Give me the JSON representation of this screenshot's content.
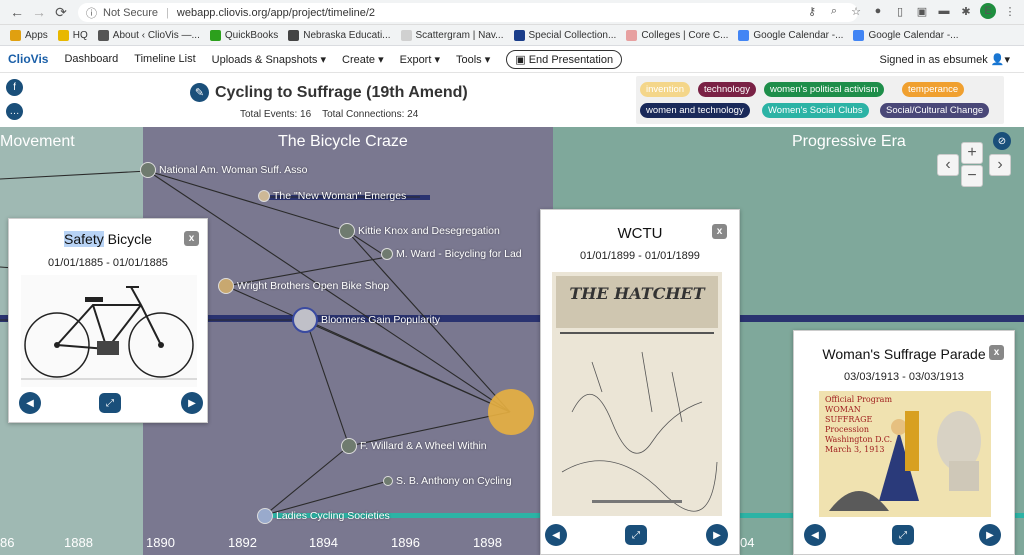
{
  "browser": {
    "not_secure": "Not Secure",
    "url": "webapp.cliovis.org/app/project/timeline/2",
    "profile_initial": "E"
  },
  "bookmarks": [
    {
      "label": "Apps",
      "color": "#e0a010"
    },
    {
      "label": "HQ",
      "color": "#e8b800"
    },
    {
      "label": "About ‹ ClioVis —...",
      "color": "#555555"
    },
    {
      "label": "QuickBooks",
      "color": "#2ca01c"
    },
    {
      "label": "Nebraska Educati...",
      "color": "#444444"
    },
    {
      "label": "Scattergram | Nav...",
      "color": "#d0d0d0"
    },
    {
      "label": "Special Collection...",
      "color": "#1a3d8a"
    },
    {
      "label": "Colleges | Core C...",
      "color": "#e7a0a0"
    },
    {
      "label": "Google Calendar -...",
      "color": "#4285f4"
    },
    {
      "label": "Google Calendar -...",
      "color": "#4285f4"
    }
  ],
  "appnav": {
    "brand": "ClioVis",
    "items": [
      "Dashboard",
      "Timeline List",
      "Uploads & Snapshots ▾",
      "Create ▾",
      "Export ▾",
      "Tools ▾"
    ],
    "end_presentation": "End Presentation",
    "signed_in": "Signed in as ebsumek"
  },
  "project": {
    "title": "Cycling to Suffrage (19th Amend)",
    "total_events": "Total Events: 16",
    "total_connections": "Total Connections: 24"
  },
  "tags": [
    {
      "label": "invention",
      "bg": "#f4d68a",
      "fg": "#ffffff"
    },
    {
      "label": "technology",
      "bg": "#7a2245",
      "fg": "#ffffff"
    },
    {
      "label": "women's political activism",
      "bg": "#1e8e4a",
      "fg": "#ffffff"
    },
    {
      "label": "temperance",
      "bg": "#f0a030",
      "fg": "#ffffff"
    },
    {
      "label": "women and technology",
      "bg": "#1a2a5a",
      "fg": "#ffffff"
    },
    {
      "label": "Women's Social Clubs",
      "bg": "#2cb3a5",
      "fg": "#ffffff"
    },
    {
      "label": "Social/Cultural Change",
      "bg": "#4a4878",
      "fg": "#ffffff"
    }
  ],
  "timeline": {
    "eras": [
      "Movement",
      "The Bicycle Craze",
      "Progressive Era"
    ],
    "years": [
      "86",
      "1888",
      "1890",
      "1892",
      "1894",
      "1896",
      "1898",
      "04"
    ],
    "events": [
      "National Am. Woman Suff. Asso",
      "The \"New Woman\" Emerges",
      "Kittie Knox and Desegregation",
      "M. Ward - Bicycling for Lad",
      "Wright Brothers Open Bike Shop",
      "Bloomers Gain Popularity",
      "F. Willard & A Wheel Within",
      "S. B. Anthony on Cycling",
      "Ladies Cycling Societies"
    ],
    "zoom_in": "+",
    "zoom_out": "−",
    "pan_left": "‹",
    "pan_right": "›"
  },
  "cards": {
    "safety": {
      "title_pre": "Safety",
      "title_post": " Bicycle",
      "date": "01/01/1885 - 01/01/1885",
      "close": "x"
    },
    "wctu": {
      "title": "WCTU",
      "date": "01/01/1899 - 01/01/1899",
      "close": "x",
      "image_caption": "THE HATCHET"
    },
    "parade": {
      "title": "Woman's Suffrage Parade",
      "date": "03/03/1913 - 03/03/1913",
      "close": "x",
      "image_caption": "Official Program WOMAN SUFFRAGE Procession Washington D.C. March 3, 1913"
    }
  },
  "icons": {
    "back": "back-arrow-icon",
    "forward": "forward-arrow-icon",
    "reload": "reload-icon",
    "info": "info-icon",
    "chat": "chat-icon",
    "edit": "edit-pencil-icon",
    "eye": "hide-eye-icon",
    "expand": "expand-icon",
    "prev": "previous-icon",
    "next": "next-icon"
  }
}
